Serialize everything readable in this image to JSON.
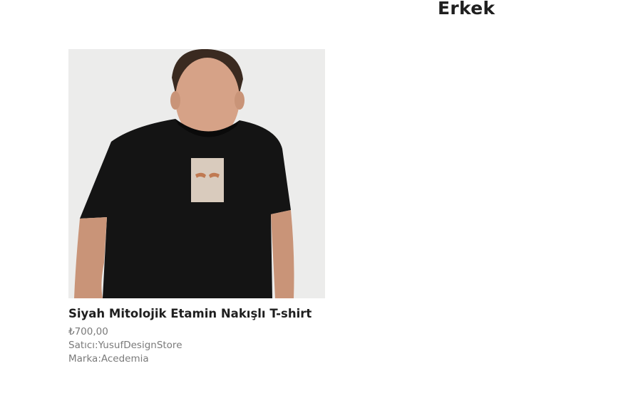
{
  "page": {
    "title": "Erkek"
  },
  "product": {
    "name": "Siyah Mitolojik Etamin Nakışlı T-shirt",
    "price": "₺700,00",
    "seller": "Satıcı:YusufDesignStore",
    "brand": "Marka:Acedemia",
    "image_icon": "product-photo-black-tshirt-model"
  },
  "colors": {
    "text_dark": "#1f1f1f",
    "text_muted": "#7a7a7a",
    "shirt": "#141414",
    "background": "#ececeb"
  }
}
